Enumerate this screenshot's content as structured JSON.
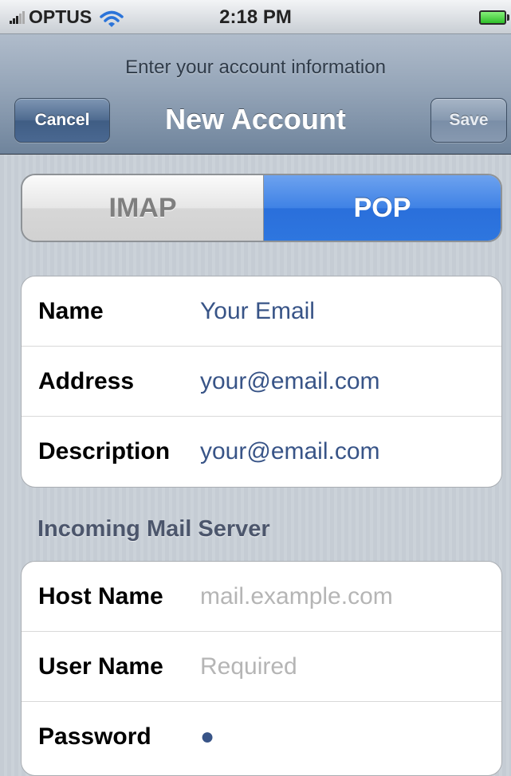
{
  "status_bar": {
    "carrier": "OPTUS",
    "time": "2:18 PM"
  },
  "nav": {
    "prompt": "Enter your account information",
    "title": "New Account",
    "cancel_label": "Cancel",
    "save_label": "Save"
  },
  "segmented": {
    "options": [
      "IMAP",
      "POP"
    ],
    "selected": "POP"
  },
  "account_fields": [
    {
      "label": "Name",
      "value": "Your Email"
    },
    {
      "label": "Address",
      "value": "your@email.com"
    },
    {
      "label": "Description",
      "value": "your@email.com"
    }
  ],
  "incoming": {
    "header": "Incoming Mail Server",
    "fields": [
      {
        "label": "Host Name",
        "placeholder": "mail.example.com"
      },
      {
        "label": "User Name",
        "placeholder": "Required"
      },
      {
        "label": "Password",
        "value": "●"
      }
    ]
  },
  "colors": {
    "selected_segment": "#2e76df",
    "field_value": "#385487",
    "placeholder": "#b5b5b5",
    "battery": "#2fbf2a"
  }
}
